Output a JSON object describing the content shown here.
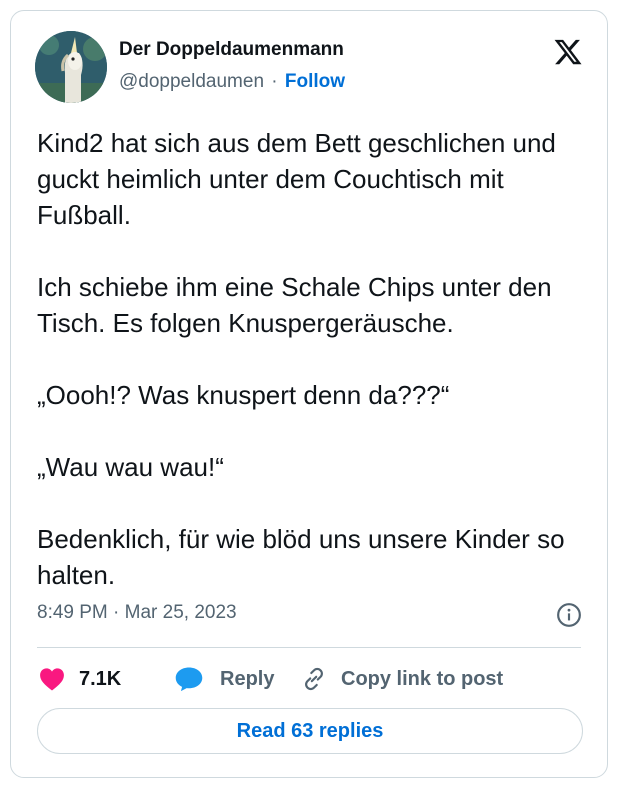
{
  "author": {
    "display_name": "Der Doppeldaumenmann",
    "handle": "@doppeldaumen",
    "separator": "·",
    "follow_label": "Follow",
    "avatar_icon": "unicorn-avatar"
  },
  "platform_icon": "x-logo-icon",
  "tweet": {
    "paragraphs": [
      "Kind2 hat sich aus dem Bett geschlichen und guckt heimlich unter dem Couchtisch mit Fußball.",
      "Ich schiebe ihm eine Schale Chips unter den Tisch. Es folgen Knuspergeräusche.",
      "„Oooh!? Was knuspert denn da???“",
      "„Wau wau wau!“",
      "Bedenklich, für wie blöd uns unsere Kinder so halten."
    ],
    "timestamp": "8:49 PM · Mar 25, 2023"
  },
  "actions": {
    "like_count": "7.1K",
    "reply_label": "Reply",
    "copy_link_label": "Copy link to post",
    "read_replies_label": "Read 63 replies"
  },
  "colors": {
    "heart": "#f91880",
    "reply_bubble": "#1d9bf0",
    "link_blue": "#006fd6",
    "border": "#cfd9de",
    "muted_text": "#536471"
  }
}
